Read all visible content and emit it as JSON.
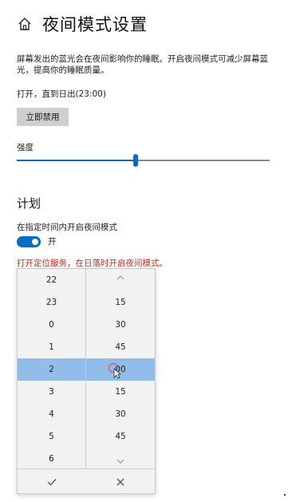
{
  "header": {
    "title": "夜间模式设置",
    "home_icon": "home-icon"
  },
  "description": "屏幕发出的蓝光会在夜间影响你的睡眠。开启夜间模式可减少屏幕蓝光，提高你的睡眠质量。",
  "status": "打开，直到日出(23:00)",
  "disable_button": "立即禁用",
  "strength": {
    "label": "强度",
    "value_fraction": 0.47
  },
  "schedule": {
    "section_title": "计划",
    "label": "在指定时间内开启夜间模式",
    "toggle_on": true,
    "toggle_label": "开",
    "warning": "打开定位服务，在日落时开启夜间模式。"
  },
  "time_picker": {
    "hours": [
      "22",
      "23",
      "0",
      "1",
      "2",
      "3",
      "4",
      "5",
      "6"
    ],
    "minutes": [
      "",
      "15",
      "30",
      "45",
      "00",
      "15",
      "30",
      "45",
      ""
    ],
    "selected_hour": "2",
    "selected_minute": "00",
    "accept_icon": "check-icon",
    "cancel_icon": "close-icon"
  },
  "colors": {
    "accent": "#0a6cc2",
    "selected_row": "#91bde8",
    "warning": "#c42b1c"
  }
}
